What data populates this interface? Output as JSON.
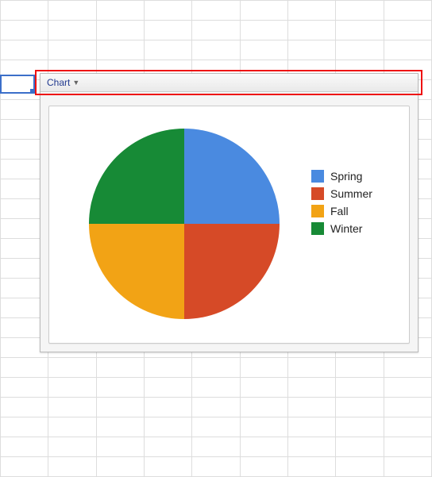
{
  "toolbar": {
    "chart_menu_label": "Chart"
  },
  "legend": {
    "items": [
      {
        "label": "Spring",
        "color": "#4a8ae0"
      },
      {
        "label": "Summer",
        "color": "#d64a27"
      },
      {
        "label": "Fall",
        "color": "#f2a315"
      },
      {
        "label": "Winter",
        "color": "#178a36"
      }
    ]
  },
  "chart_data": {
    "type": "pie",
    "title": "",
    "categories": [
      "Spring",
      "Summer",
      "Fall",
      "Winter"
    ],
    "values": [
      25,
      25,
      25,
      25
    ],
    "colors": [
      "#4a8ae0",
      "#d64a27",
      "#f2a315",
      "#178a36"
    ],
    "legend_position": "right"
  }
}
